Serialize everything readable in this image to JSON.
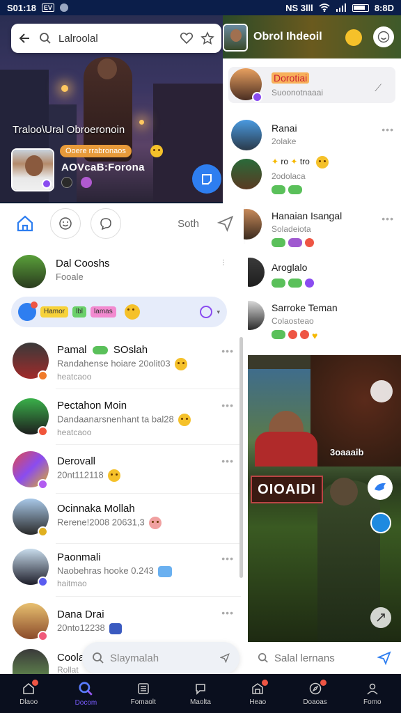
{
  "status_bar": {
    "left_text": "S01:18",
    "box_label": "EV",
    "right_text": "NS 3lll",
    "time": "8:8D"
  },
  "hero": {
    "search_text": "Lalroolal",
    "caption": "Traloo\\Ural Obroeronoin",
    "tag": "Ooere rrabronaos",
    "name": "AOVcaB:Forona"
  },
  "tabs": {
    "label": "Soth"
  },
  "chip_bar": {
    "chips": [
      "Hamor",
      "lbl",
      "lamas"
    ]
  },
  "left_list": [
    {
      "name": "Dal Cooshs",
      "line1": "Fooale",
      "line2": "",
      "badge_color": "#3a9a3a"
    },
    {
      "name": "Pamal",
      "tag": "SOslah",
      "line1": "Randahense hoiare 20olit03",
      "line2": "heatcaoo",
      "badge_color": "#f07a2a"
    },
    {
      "name": "Pectahon Moin",
      "line1": "Dandaanarsnenhant ta bal28",
      "line2": "heatcaoo",
      "badge_color": "#f0553a"
    },
    {
      "name": "Derovall",
      "line1": "20nt112118",
      "line2": "",
      "badge_color": "#b25cf0"
    },
    {
      "name": "Ocinnaka Mollah",
      "line1": "Rerene!2008 20631,3",
      "line2": "",
      "badge_color": "#e0b020"
    },
    {
      "name": "Paonmali",
      "line1": "Naobehras hooke 0.243",
      "line2": "haitmao",
      "badge_color": "#5a5cf0"
    },
    {
      "name": "Dana Drai",
      "line1": "20nto12238",
      "line2": "",
      "badge_color": "#f05a7a"
    },
    {
      "name": "Coola",
      "line1": "Rollat",
      "line2": "",
      "badge_color": "#3a9a3a"
    }
  ],
  "float_search": {
    "placeholder": "Slaymalah"
  },
  "right_header": {
    "title": "Obrol Ihdeoil"
  },
  "right_list": [
    {
      "name": "Dorotiai",
      "sub": "Suoonotnaaai",
      "highlight": true
    },
    {
      "name": "Ranai",
      "sub": "2olake"
    },
    {
      "name": "",
      "sub": "2odolaca",
      "emoji_text_1": "ro",
      "emoji_text_2": "tro"
    },
    {
      "name": "Hanaian Isangal",
      "sub": "Soladeiota"
    },
    {
      "name": "Aroglalo",
      "sub": ""
    },
    {
      "name": "Sarroke Teman",
      "sub": "Colaosteao"
    }
  ],
  "game": {
    "banner": "OIOAIDI",
    "score": "3oaaaib"
  },
  "right_search": {
    "placeholder": "Salal lernans"
  },
  "bottom_nav": [
    {
      "label": "Dlaoo",
      "icon": "home-icon",
      "badge": true
    },
    {
      "label": "Docom",
      "icon": "search-icon",
      "badge": false
    },
    {
      "label": "Fomaolt",
      "icon": "list-icon",
      "badge": false
    },
    {
      "label": "Maolta",
      "icon": "chat-icon",
      "badge": false
    },
    {
      "label": "Heao",
      "icon": "inbox-icon",
      "badge": true
    },
    {
      "label": "Doaoas",
      "icon": "compass-icon",
      "badge": true
    },
    {
      "label": "Fomo",
      "icon": "profile-icon",
      "badge": false
    }
  ],
  "colors": {
    "accent": "#2e7ef0",
    "nav_active": "#7a5cff",
    "status_bg": "#0b1e4a"
  }
}
